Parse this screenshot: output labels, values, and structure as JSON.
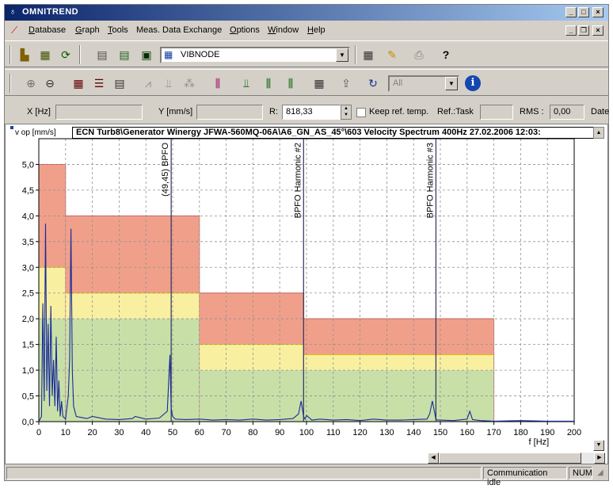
{
  "window": {
    "title": "OMNITREND"
  },
  "menu": {
    "items": [
      {
        "label": "Database",
        "key": "D",
        "rest": "atabase"
      },
      {
        "label": "Graph",
        "key": "G",
        "rest": "raph"
      },
      {
        "label": "Tools",
        "key": "T",
        "rest": "ools"
      },
      {
        "label": "Meas. Data Exchange",
        "key": "",
        "rest": "Meas. Data Exchange"
      },
      {
        "label": "Options",
        "key": "O",
        "rest": "ptions"
      },
      {
        "label": "Window",
        "key": "W",
        "rest": "indow"
      },
      {
        "label": "Help",
        "key": "H",
        "rest": "elp"
      }
    ]
  },
  "toolbar1": {
    "node_combo": "VIBNODE"
  },
  "toolbar2": {
    "filter_combo": "All"
  },
  "fields": {
    "x_label": "X [Hz]",
    "x_value": "",
    "y_label": "Y [mm/s]",
    "y_value": "",
    "r_label": "R:",
    "r_value": "818,33",
    "keep_ref_label": "Keep ref. temp.",
    "ref_task_label": "Ref.:Task",
    "ref_task_value": "",
    "rms_label": "RMS :",
    "rms_value": "0,00",
    "date_label": "Date"
  },
  "chart": {
    "path_title": "ECN Turb8\\Generator Winergy JFWA-560MQ-06A\\A6_GN_AS_45°\\603 Velocity Spectrum 400Hz 27.02.2006 12:03:",
    "y_axis_label": "v op [mm/s]",
    "x_axis_label": "f [Hz]",
    "colors": {
      "red": "#f0a08a",
      "yellow": "#f8f0a0",
      "green": "#c8e0a8",
      "band_edge": "#e05050",
      "trace": "#1a2a9a",
      "marker": "#303060"
    }
  },
  "chart_data": {
    "type": "line",
    "xlim": [
      0,
      200
    ],
    "ylim": [
      0,
      5.5
    ],
    "x_ticks": [
      "0",
      "10",
      "20",
      "30",
      "40",
      "50",
      "60",
      "70",
      "80",
      "90",
      "100",
      "110",
      "120",
      "130",
      "140",
      "150",
      "160",
      "170",
      "180",
      "190",
      "200"
    ],
    "y_ticks": [
      "0,0",
      "0,5",
      "1,0",
      "1,5",
      "2,0",
      "2,5",
      "3,0",
      "3,5",
      "4,0",
      "4,5",
      "5,0"
    ],
    "grid": true,
    "alarm_bands": [
      {
        "x0": 0,
        "x1": 10,
        "green": 2.0,
        "yellow": 3.0,
        "red": 5.0
      },
      {
        "x0": 10,
        "x1": 60,
        "green": 2.0,
        "yellow": 2.5,
        "red": 4.0
      },
      {
        "x0": 60,
        "x1": 99,
        "green": 1.0,
        "yellow": 1.5,
        "red": 2.5
      },
      {
        "x0": 99,
        "x1": 170,
        "green": 1.0,
        "yellow": 1.3,
        "red": 2.0
      }
    ],
    "markers": [
      {
        "x": 49.45,
        "label": "(49,45) BPFO"
      },
      {
        "x": 98.9,
        "label": "BPFO Harmonic #2"
      },
      {
        "x": 148.35,
        "label": "BPFO Harmonic #3"
      }
    ],
    "spectrum": {
      "x": [
        0,
        1,
        1.5,
        2,
        2.5,
        3,
        3.5,
        4,
        4.5,
        5,
        5.5,
        6,
        6.5,
        7,
        7.5,
        8,
        8.5,
        9,
        10,
        11,
        11.5,
        12,
        12.5,
        13,
        14,
        16,
        18,
        20,
        25,
        30,
        35,
        36,
        40,
        45,
        48,
        49,
        49.45,
        50,
        51,
        55,
        60,
        65,
        70,
        75,
        80,
        85,
        90,
        95,
        97,
        98,
        98.9,
        99.5,
        100,
        102,
        105,
        110,
        115,
        120,
        125,
        130,
        135,
        140,
        145,
        146,
        147,
        148.35,
        149,
        150,
        155,
        160,
        161,
        162,
        165,
        170,
        180,
        190,
        200
      ],
      "y": [
        0,
        0.1,
        2.3,
        0.4,
        3.85,
        0.6,
        1.9,
        0.3,
        2.25,
        0.5,
        1.2,
        0.3,
        1.65,
        0.2,
        0.8,
        0.1,
        0.4,
        0.1,
        0.05,
        0.5,
        1.2,
        3.75,
        1.0,
        0.3,
        0.1,
        0.08,
        0.06,
        0.1,
        0.05,
        0.04,
        0.06,
        0.1,
        0.05,
        0.07,
        0.2,
        1.3,
        0.25,
        0.1,
        0.05,
        0.04,
        0.05,
        0.03,
        0.04,
        0.03,
        0.05,
        0.03,
        0.04,
        0.06,
        0.15,
        0.4,
        0.1,
        0.05,
        0.12,
        0.03,
        0.05,
        0.03,
        0.04,
        0.02,
        0.05,
        0.03,
        0.03,
        0.04,
        0.05,
        0.15,
        0.4,
        0.05,
        0.03,
        0.03,
        0.02,
        0.05,
        0.2,
        0.04,
        0.02,
        0.01,
        0.02,
        0.01,
        0.01
      ]
    }
  },
  "status": {
    "comm": "Communication idle",
    "num": "NUM"
  }
}
